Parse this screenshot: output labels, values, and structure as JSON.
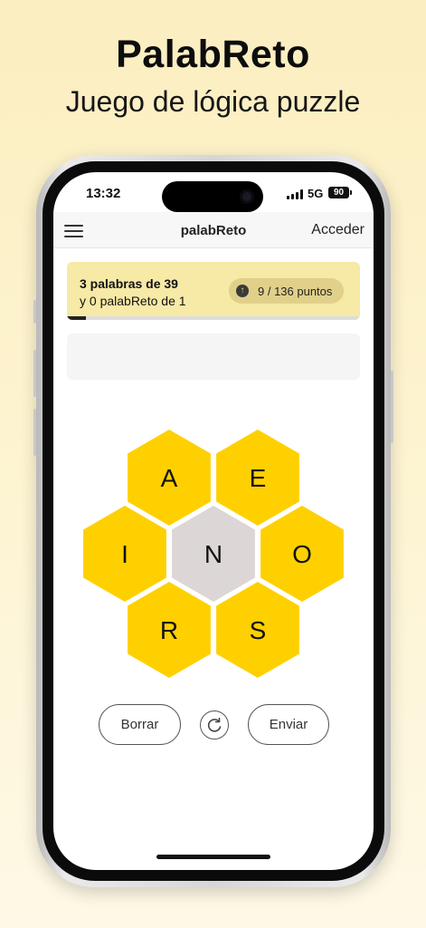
{
  "promo": {
    "title": "PalabReto",
    "subtitle": "Juego de lógica puzzle"
  },
  "status_bar": {
    "time": "13:32",
    "network": "5G",
    "battery": "90"
  },
  "header": {
    "menu_icon": "hamburger-menu-icon",
    "title": "palabReto",
    "login_label": "Acceder"
  },
  "progress": {
    "words_text": "3 palabras de 39",
    "palabreto_text": "y 0 palabReto de 1",
    "points_text": "9 / 136 puntos",
    "points_icon": "arrow-up-circle-icon",
    "points_fraction": 0.066
  },
  "input": {
    "value": ""
  },
  "hive": {
    "center": "N",
    "outer": [
      "A",
      "E",
      "I",
      "O",
      "R",
      "S"
    ]
  },
  "actions": {
    "delete_label": "Borrar",
    "shuffle_icon": "shuffle-rotate-icon",
    "submit_label": "Enviar"
  },
  "colors": {
    "accent": "#ffd000",
    "center_cell": "#dcd6d6",
    "card": "#f7e9a6",
    "background": "#fdf3cf"
  }
}
